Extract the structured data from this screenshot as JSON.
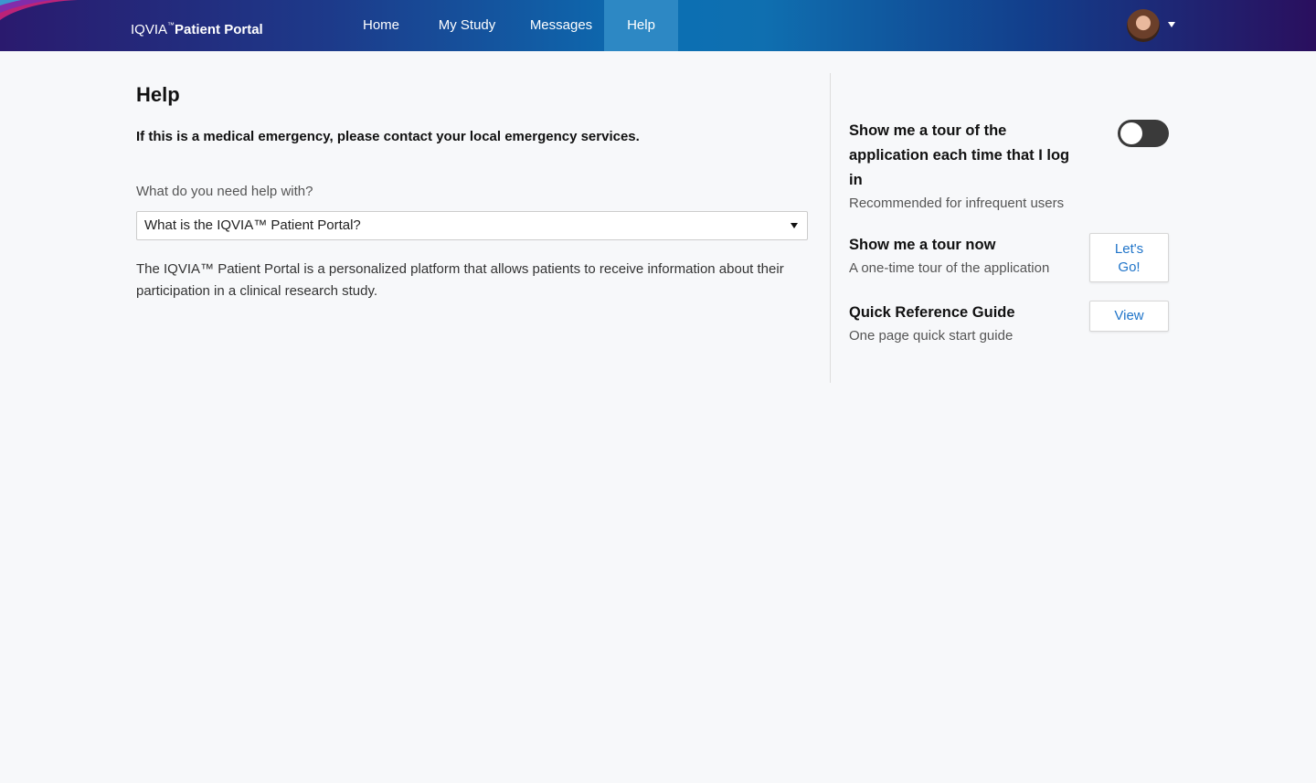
{
  "header": {
    "brand": {
      "prefix": "IQVIA",
      "tm": "™",
      "name": "Patient Portal"
    },
    "nav": [
      {
        "label": "Home",
        "active": false
      },
      {
        "label": "My Study",
        "active": false
      },
      {
        "label": "Messages",
        "active": false
      },
      {
        "label": "Help",
        "active": true
      }
    ],
    "avatar_icon": "user-avatar",
    "menu_icon": "caret-down-icon"
  },
  "main": {
    "title": "Help",
    "emergency_notice": "If this is a medical emergency, please contact your local emergency services.",
    "help_label": "What do you need help with?",
    "help_select_value": "What is the IQVIA™ Patient Portal?",
    "answer": "The IQVIA™ Patient Portal is a personalized platform that allows patients to receive information about their participation in a clinical research study."
  },
  "side": {
    "tour_each_login": {
      "title": "Show me a tour of the application each time that I log in",
      "subtitle": "Recommended for infrequent users",
      "enabled": false
    },
    "tour_now": {
      "title": "Show me a tour now",
      "subtitle": "A one-time tour of the application",
      "button_label": "Let's Go!"
    },
    "quick_reference": {
      "title": "Quick Reference Guide",
      "subtitle": "One page quick start guide",
      "button_label": "View"
    }
  },
  "colors": {
    "accent": "#1f74c9",
    "nav_active": "#2d88c4",
    "toggle_off": "#3a3a3a"
  }
}
